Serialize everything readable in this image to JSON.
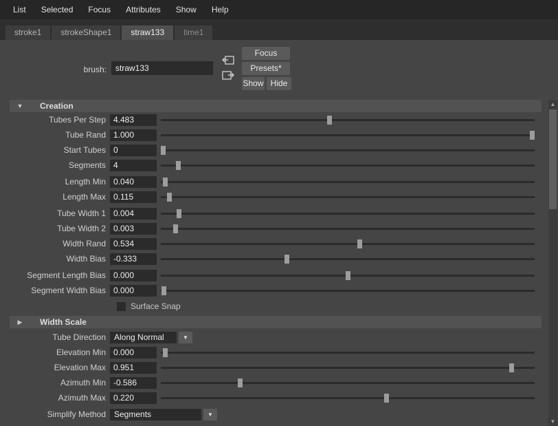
{
  "colors": {
    "background": "#454545",
    "menubar": "#262626",
    "tabstrip": "#2e2e2e",
    "tab_active": "#4f4f4f",
    "field": "#2b2b2b",
    "section_header": "#525252",
    "button": "#5a5a5a",
    "slider_thumb": "#9d9d9d"
  },
  "menubar": {
    "items": [
      "List",
      "Selected",
      "Focus",
      "Attributes",
      "Show",
      "Help"
    ]
  },
  "tabs": {
    "items": [
      {
        "label": "stroke1"
      },
      {
        "label": "strokeShape1"
      },
      {
        "label": "straw133"
      },
      {
        "label": "time1"
      }
    ]
  },
  "header": {
    "brush_label": "brush:",
    "brush_value": "straw133",
    "buttons": {
      "focus": "Focus",
      "presets": "Presets*",
      "show": "Show",
      "hide": "Hide"
    }
  },
  "creation": {
    "title": "Creation",
    "expand_icon": "▼",
    "rows": [
      {
        "label": "Tubes Per Step",
        "value": "4.483",
        "pos": 0.45
      },
      {
        "label": "Tube Rand",
        "value": "1.000",
        "pos": 1.0
      },
      {
        "label": "Start Tubes",
        "value": "0",
        "pos": 0.0
      },
      {
        "label": "Segments",
        "value": "4",
        "pos": 0.041
      },
      {
        "label": "Length Min",
        "value": "0.040",
        "pos": 0.006
      },
      {
        "label": "Length Max",
        "value": "0.115",
        "pos": 0.017
      },
      {
        "label": "Tube Width 1",
        "value": "0.004",
        "pos": 0.042
      },
      {
        "label": "Tube Width 2",
        "value": "0.003",
        "pos": 0.034
      },
      {
        "label": "Width Rand",
        "value": "0.534",
        "pos": 0.533
      },
      {
        "label": "Width Bias",
        "value": "-0.333",
        "pos": 0.336
      },
      {
        "label": "Segment Length Bias",
        "value": "0.000",
        "pos": 0.5
      },
      {
        "label": "Segment Width Bias",
        "value": "0.000",
        "pos": 0.002
      }
    ],
    "surface_snap_label": "Surface Snap",
    "surface_snap_checked": false
  },
  "width_scale": {
    "title": "Width Scale",
    "expand_icon": "▶"
  },
  "direction": {
    "tube_direction_label": "Tube Direction",
    "tube_direction_value": "Along Normal",
    "dropdown_icon": "▼",
    "rows": [
      {
        "label": "Elevation Min",
        "value": "0.000",
        "pos": 0.005
      },
      {
        "label": "Elevation Max",
        "value": "0.951",
        "pos": 0.944
      },
      {
        "label": "Azimuth Min",
        "value": "-0.586",
        "pos": 0.208
      },
      {
        "label": "Azimuth Max",
        "value": "0.220",
        "pos": 0.606
      }
    ],
    "simplify_label": "Simplify Method",
    "simplify_value": "Segments"
  },
  "scrollbar": {
    "up_icon": "▲",
    "down_icon": "▼"
  }
}
